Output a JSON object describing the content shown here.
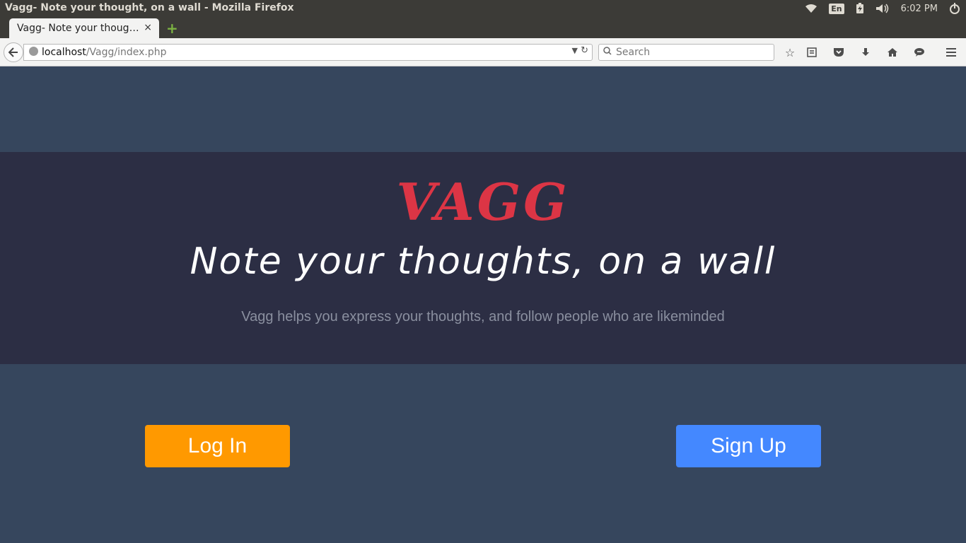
{
  "os": {
    "window_title": "Vagg- Note your thought, on a wall - Mozilla Firefox",
    "keyboard_layout": "En",
    "clock": "6:02 PM"
  },
  "browser": {
    "tab_title": "Vagg- Note your though...",
    "tab_close": "×",
    "new_tab": "+",
    "url_host": "localhost",
    "url_path": "/Vagg/index.php",
    "search_placeholder": "Search",
    "icons": [
      "bookmark-star-icon",
      "reading-list-icon",
      "pocket-icon",
      "download-icon",
      "home-icon",
      "chat-icon",
      "menu-icon"
    ]
  },
  "hero": {
    "brand": "VAGG",
    "tagline": "Note your thoughts, on a wall",
    "subtitle": "Vagg helps you express your thoughts, and follow people who are likeminded"
  },
  "actions": {
    "login_label": "Log In",
    "signup_label": "Sign Up"
  },
  "colors": {
    "page_bg": "#36465d",
    "hero_bg": "#2c2e44",
    "brand": "#dc3545",
    "login": "#ff9900",
    "signup": "#4488ff"
  }
}
